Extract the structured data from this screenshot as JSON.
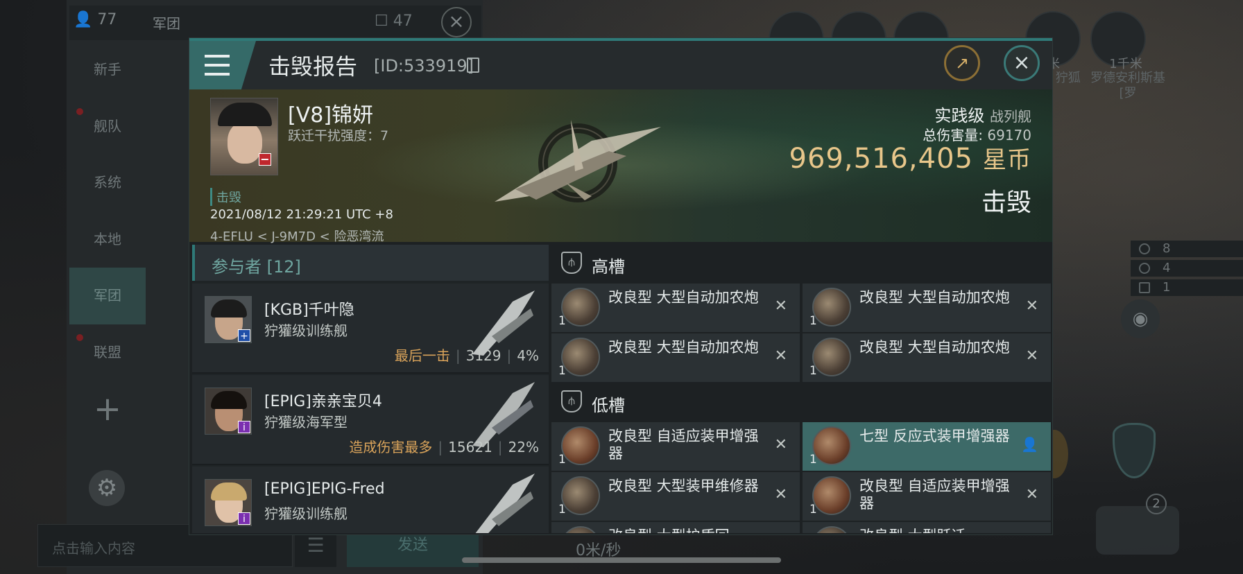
{
  "chat": {
    "member_count": "77",
    "channel_name": "军团",
    "unread_count": "47",
    "channels": [
      "新手",
      "舰队",
      "系统",
      "本地",
      "军团",
      "联盟"
    ],
    "input_placeholder": "点击输入内容",
    "send_label": "发送"
  },
  "hud": {
    "range_1": "1千米",
    "range_2": "米",
    "target_name": "罗德安利斯基 [罗",
    "target_name_2": "白 狞狐",
    "stats": [
      "8",
      "4",
      "1"
    ],
    "drone_count": "2",
    "speed": "0米/秒"
  },
  "report": {
    "title": "击毁报告",
    "id": "[ID:533919]",
    "victim": {
      "name": "[V8]锦妍",
      "warp_scramble": "跃迁干扰强度：7",
      "tag": "击毁",
      "time": "2021/08/12 21:29:21 UTC +8",
      "location": "4-EFLU < J-9M7D < 险恶湾流"
    },
    "ship_class": "实践级",
    "ship_type": "战列舰",
    "total_damage_label": "总伤害量:",
    "total_damage": "69170",
    "isk_value": "969,516,405",
    "isk_unit": "星币",
    "result": "击毁"
  },
  "participants": {
    "title": "参与者 [12]",
    "rows": [
      {
        "name": "[KGB]千叶隐",
        "ship": "狞獾级训练舰",
        "tag": "最后一击",
        "damage": "3129",
        "percent": "4%",
        "badge": "+",
        "badge_color": "#1f4fa8"
      },
      {
        "name": "[EPIG]亲亲宝贝4",
        "ship": "狞獾级海军型",
        "tag": "造成伤害最多",
        "damage": "15621",
        "percent": "22%",
        "badge": "i",
        "badge_color": "#7b2fb0"
      },
      {
        "name": "[EPIG]EPIG-Fred",
        "ship": "狞獾级训练舰",
        "tag": "",
        "damage": "",
        "percent": "",
        "badge": "i",
        "badge_color": "#7b2fb0"
      }
    ]
  },
  "fitting": {
    "high_slot_label": "高槽",
    "low_slot_label": "低槽",
    "high": [
      {
        "name": "改良型 大型自动加农炮",
        "qty": "1"
      },
      {
        "name": "改良型 大型自动加农炮",
        "qty": "1"
      },
      {
        "name": "改良型 大型自动加农炮",
        "qty": "1"
      },
      {
        "name": "改良型 大型自动加农炮",
        "qty": "1"
      }
    ],
    "low": [
      {
        "name": "改良型 自适应装甲增强器",
        "qty": "1"
      },
      {
        "name": "七型 反应式装甲增强器",
        "qty": "1"
      },
      {
        "name": "改良型 大型装甲维修器",
        "qty": "1"
      },
      {
        "name": "改良型 自适应装甲增强器",
        "qty": "1"
      },
      {
        "name": "改良型 大型护盾回",
        "qty": ""
      },
      {
        "name": "改良型 大型跃迁",
        "qty": ""
      }
    ]
  },
  "colors": {
    "accent": "#2f7a78",
    "isk": "#e8c68a",
    "tag": "#d9a35a",
    "danger": "#c0272d"
  }
}
